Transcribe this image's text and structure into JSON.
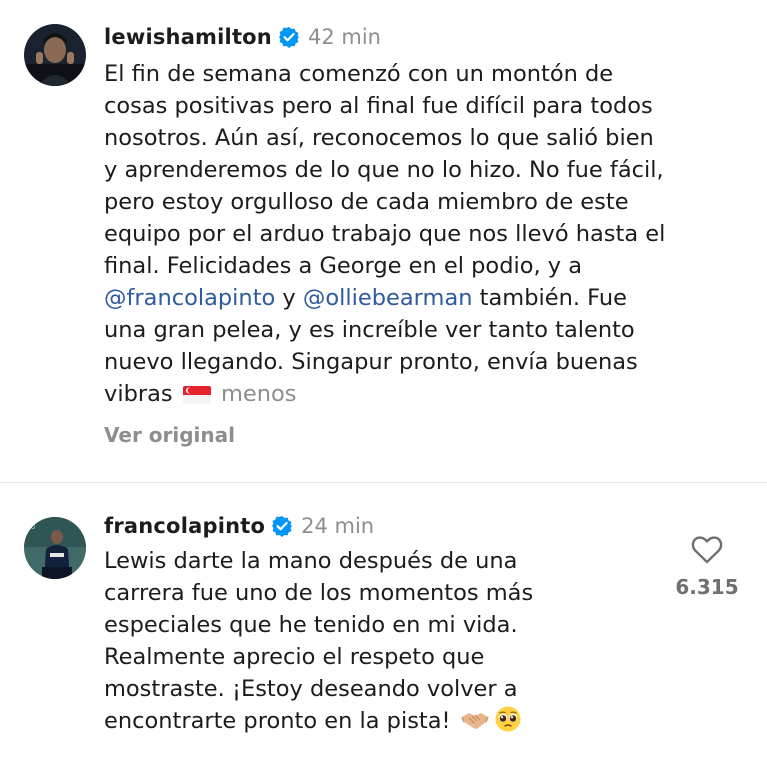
{
  "comments": [
    {
      "username": "lewishamilton",
      "time": "42 min",
      "lines": [
        "El fin de semana comenzó con un montón de",
        "cosas positivas pero al final fue difícil para todos",
        "nosotros. Aún así, reconocemos lo que salió bien",
        "y aprenderemos de lo que no lo hizo. No fue fácil,",
        "pero estoy orgulloso de cada miembro de este",
        "equipo por el arduo trabajo que nos llevó hasta el",
        "final. Felicidades a George en el podio, y a"
      ],
      "mention1": "@francolapinto",
      "connector": " y ",
      "mention2": "@olliebearman",
      "after_mentions": " también. Fue",
      "lines2": [
        "una gran pelea, y es increíble ver tanto talento",
        "nuevo llegando. Singapur pronto, envía buenas"
      ],
      "last_line": "vibras",
      "flag_emoji": "singapore-flag",
      "more_label": "menos",
      "see_original_label": "Ver original"
    },
    {
      "username": "francolapinto",
      "time": "24 min",
      "lines": [
        "Lewis darte la mano después de una",
        "carrera fue uno de los momentos más",
        "especiales que he tenido en mi vida.",
        "Realmente aprecio el respeto que",
        "mostraste. ¡Estoy deseando volver a"
      ],
      "last_line": "encontrarte pronto en la pista!",
      "emojis": [
        "handshake-emoji",
        "pleading-face-emoji"
      ],
      "like_count": "6.315"
    }
  ],
  "colors": {
    "verified": "#0095f6",
    "mention": "#2f5a9e",
    "muted": "#8e8e8e"
  }
}
